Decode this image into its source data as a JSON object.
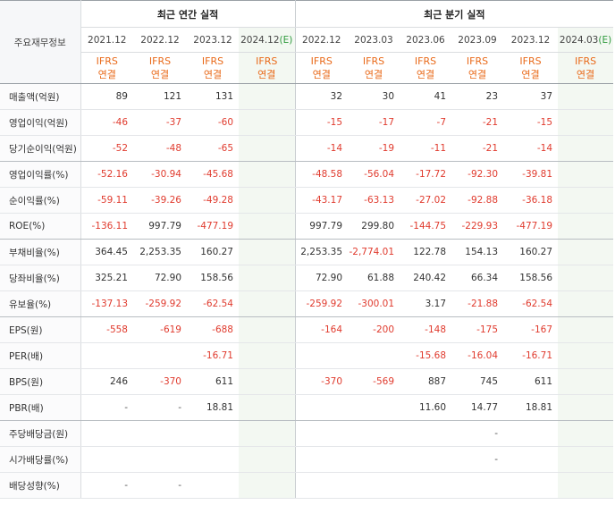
{
  "table": {
    "label_header": "주요재무정보",
    "groups": {
      "annual": "최근 연간 실적",
      "quarterly": "최근 분기 실적"
    },
    "periods": [
      {
        "date": "2021.12",
        "est": "",
        "standard": [
          "IFRS",
          "연결"
        ]
      },
      {
        "date": "2022.12",
        "est": "",
        "standard": [
          "IFRS",
          "연결"
        ]
      },
      {
        "date": "2023.12",
        "est": "",
        "standard": [
          "IFRS",
          "연결"
        ]
      },
      {
        "date": "2024.12",
        "est": "(E)",
        "standard": [
          "IFRS",
          "연결"
        ]
      },
      {
        "date": "2022.12",
        "est": "",
        "standard": [
          "IFRS",
          "연결"
        ]
      },
      {
        "date": "2023.03",
        "est": "",
        "standard": [
          "IFRS",
          "연결"
        ]
      },
      {
        "date": "2023.06",
        "est": "",
        "standard": [
          "IFRS",
          "연결"
        ]
      },
      {
        "date": "2023.09",
        "est": "",
        "standard": [
          "IFRS",
          "연결"
        ]
      },
      {
        "date": "2023.12",
        "est": "",
        "standard": [
          "IFRS",
          "연결"
        ]
      },
      {
        "date": "2024.03",
        "est": "(E)",
        "standard": [
          "IFRS",
          "연결"
        ]
      }
    ],
    "rows": [
      {
        "label": "매출액(억원)",
        "values": [
          "89",
          "121",
          "131",
          "",
          "32",
          "30",
          "41",
          "23",
          "37",
          ""
        ]
      },
      {
        "label": "영업이익(억원)",
        "values": [
          "-46",
          "-37",
          "-60",
          "",
          "-15",
          "-17",
          "-7",
          "-21",
          "-15",
          ""
        ]
      },
      {
        "label": "당기순이익(억원)",
        "values": [
          "-52",
          "-48",
          "-65",
          "",
          "-14",
          "-19",
          "-11",
          "-21",
          "-14",
          ""
        ]
      },
      {
        "label": "영업이익률(%)",
        "values": [
          "-52.16",
          "-30.94",
          "-45.68",
          "",
          "-48.58",
          "-56.04",
          "-17.72",
          "-92.30",
          "-39.81",
          ""
        ]
      },
      {
        "label": "순이익률(%)",
        "values": [
          "-59.11",
          "-39.26",
          "-49.28",
          "",
          "-43.17",
          "-63.13",
          "-27.02",
          "-92.88",
          "-36.18",
          ""
        ]
      },
      {
        "label": "ROE(%)",
        "values": [
          "-136.11",
          "997.79",
          "-477.19",
          "",
          "997.79",
          "299.80",
          "-144.75",
          "-229.93",
          "-477.19",
          ""
        ]
      },
      {
        "label": "부채비율(%)",
        "values": [
          "364.45",
          "2,253.35",
          "160.27",
          "",
          "2,253.35",
          "-2,774.01",
          "122.78",
          "154.13",
          "160.27",
          ""
        ]
      },
      {
        "label": "당좌비율(%)",
        "values": [
          "325.21",
          "72.90",
          "158.56",
          "",
          "72.90",
          "61.88",
          "240.42",
          "66.34",
          "158.56",
          ""
        ]
      },
      {
        "label": "유보율(%)",
        "values": [
          "-137.13",
          "-259.92",
          "-62.54",
          "",
          "-259.92",
          "-300.01",
          "3.17",
          "-21.88",
          "-62.54",
          ""
        ]
      },
      {
        "label": "EPS(원)",
        "values": [
          "-558",
          "-619",
          "-688",
          "",
          "-164",
          "-200",
          "-148",
          "-175",
          "-167",
          ""
        ]
      },
      {
        "label": "PER(배)",
        "values": [
          "",
          "",
          "-16.71",
          "",
          "",
          "",
          "-15.68",
          "-16.04",
          "-16.71",
          ""
        ]
      },
      {
        "label": "BPS(원)",
        "values": [
          "246",
          "-370",
          "611",
          "",
          "-370",
          "-569",
          "887",
          "745",
          "611",
          ""
        ]
      },
      {
        "label": "PBR(배)",
        "values": [
          "-",
          "-",
          "18.81",
          "",
          "",
          "",
          "11.60",
          "14.77",
          "18.81",
          ""
        ]
      },
      {
        "label": "주당배당금(원)",
        "values": [
          "",
          "",
          "",
          "",
          "",
          "",
          "",
          "-",
          "",
          ""
        ]
      },
      {
        "label": "시가배당률(%)",
        "values": [
          "",
          "",
          "",
          "",
          "",
          "",
          "",
          "-",
          "",
          ""
        ]
      },
      {
        "label": "배당성향(%)",
        "values": [
          "-",
          "-",
          "",
          "",
          "",
          "",
          "",
          "",
          "",
          ""
        ]
      }
    ]
  },
  "colors": {
    "negative": "#e03b2e",
    "standard": "#e96a1a",
    "estimate": "#2e9a3c",
    "estimate_column_bg": "#f3f8f2"
  }
}
